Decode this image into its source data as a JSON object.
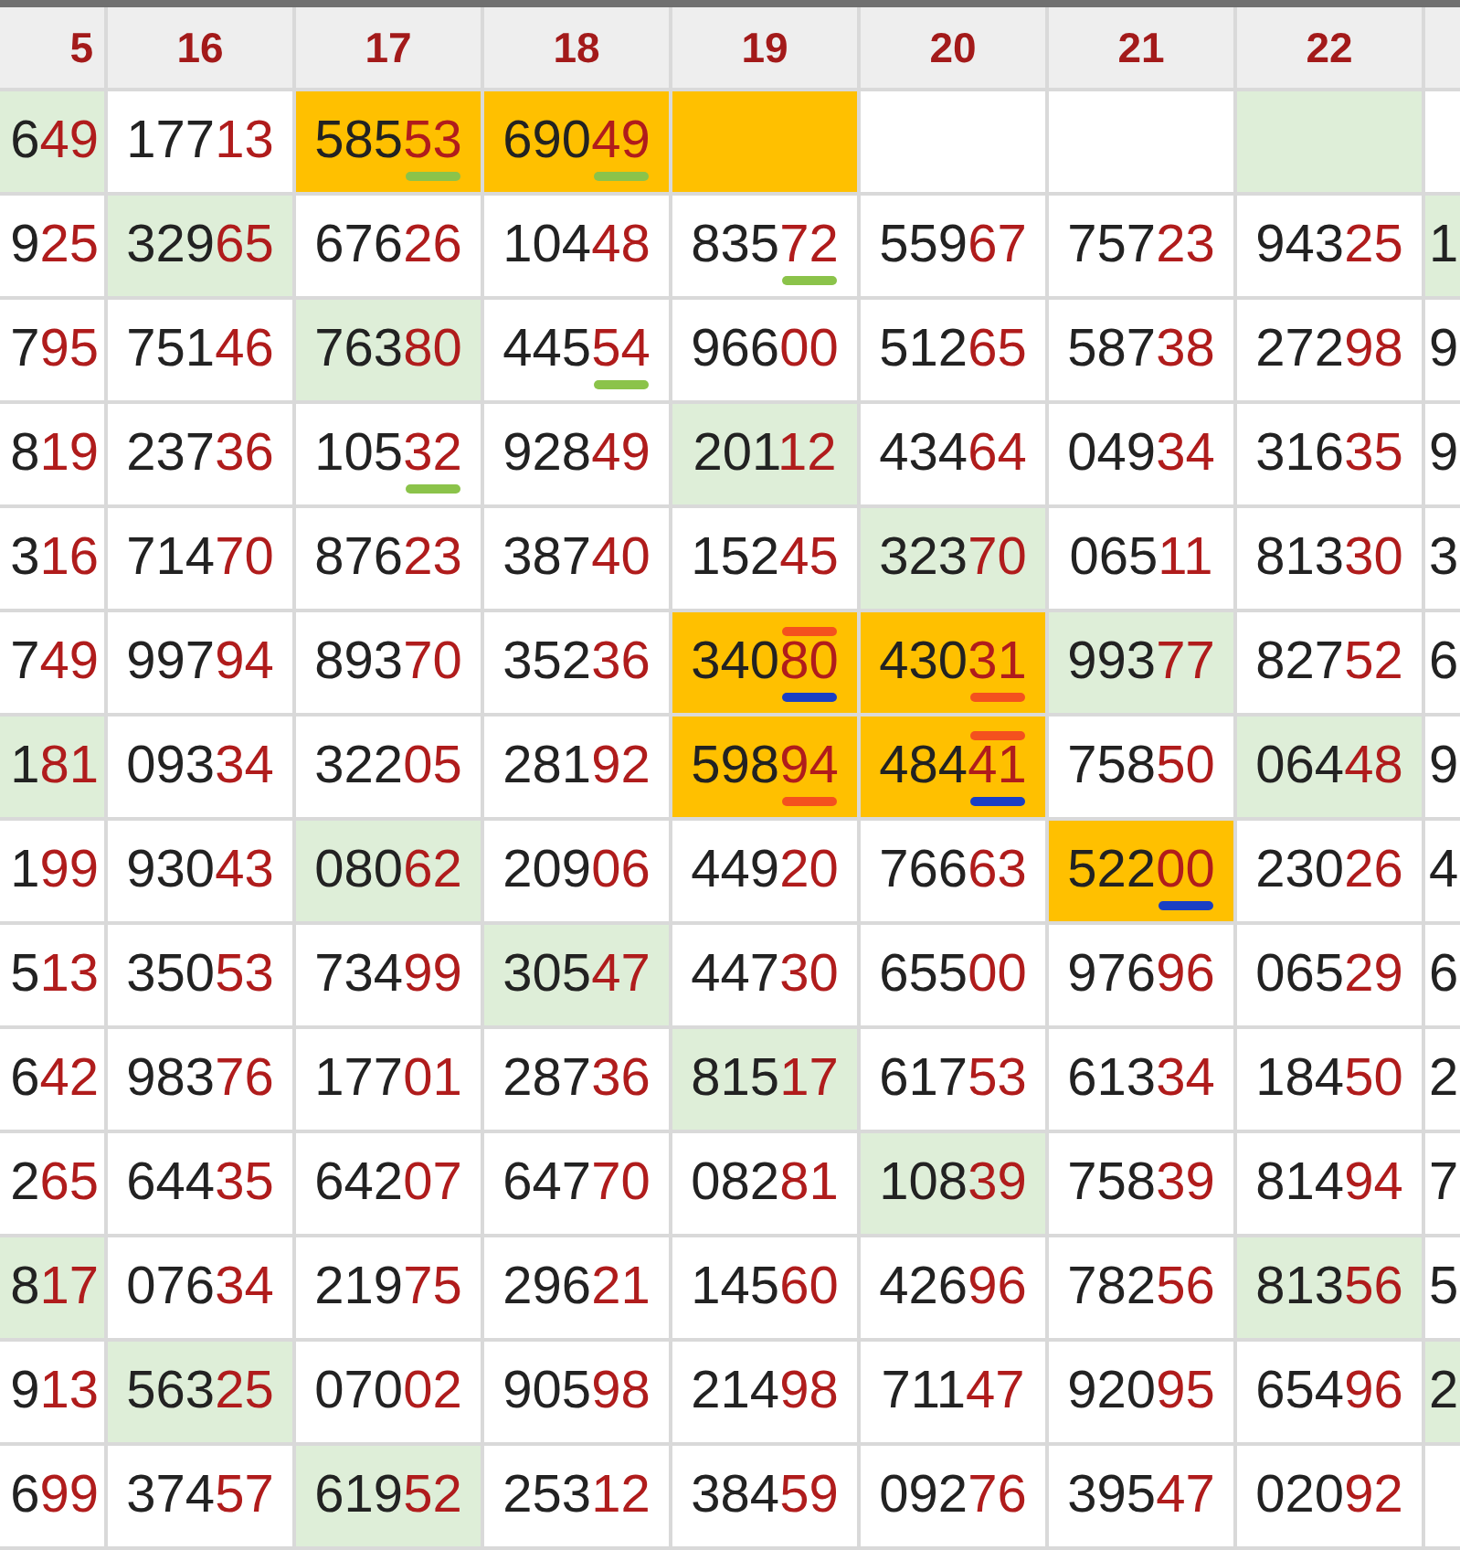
{
  "header": [
    "5",
    "16",
    "17",
    "18",
    "19",
    "20",
    "21",
    "22"
  ],
  "rows": [
    {
      "cells": [
        {
          "text": "649",
          "color": "#deeed8"
        },
        {
          "text": "17713"
        },
        {
          "text": "58553",
          "color": "#ffc000",
          "marks": [
            {
              "kind": "underline",
              "color": "#8bc34a"
            }
          ]
        },
        {
          "text": "69049",
          "color": "#ffc000",
          "marks": [
            {
              "kind": "underline",
              "color": "#8bc34a"
            }
          ]
        },
        {
          "color": "#ffc000"
        },
        {},
        {},
        {
          "color": "#deeed8"
        },
        {}
      ]
    },
    {
      "cells": [
        {
          "text": "925"
        },
        {
          "text": "32965",
          "color": "#deeed8"
        },
        {
          "text": "67626"
        },
        {
          "text": "10448"
        },
        {
          "text": "83572",
          "marks": [
            {
              "kind": "underline",
              "color": "#8bc34a"
            }
          ]
        },
        {
          "text": "55967"
        },
        {
          "text": "75723"
        },
        {
          "text": "94325"
        },
        {
          "text": "1",
          "color": "#deeed8"
        }
      ]
    },
    {
      "cells": [
        {
          "text": "795"
        },
        {
          "text": "75146"
        },
        {
          "text": "76380",
          "color": "#deeed8"
        },
        {
          "text": "44554",
          "marks": [
            {
              "kind": "underline",
              "color": "#8bc34a"
            }
          ]
        },
        {
          "text": "96600"
        },
        {
          "text": "51265"
        },
        {
          "text": "58738"
        },
        {
          "text": "27298"
        },
        {
          "text": "9"
        }
      ]
    },
    {
      "cells": [
        {
          "text": "819"
        },
        {
          "text": "23736"
        },
        {
          "text": "10532",
          "marks": [
            {
              "kind": "underline",
              "color": "#8bc34a"
            }
          ]
        },
        {
          "text": "92849"
        },
        {
          "text": "20112",
          "color": "#deeed8"
        },
        {
          "text": "43464"
        },
        {
          "text": "04934"
        },
        {
          "text": "31635"
        },
        {
          "text": "9"
        }
      ]
    },
    {
      "cells": [
        {
          "text": "316"
        },
        {
          "text": "71470"
        },
        {
          "text": "87623"
        },
        {
          "text": "38740"
        },
        {
          "text": "15245"
        },
        {
          "text": "32370",
          "color": "#deeed8"
        },
        {
          "text": "06511"
        },
        {
          "text": "81330"
        },
        {
          "text": "3"
        }
      ]
    },
    {
      "cells": [
        {
          "text": "749"
        },
        {
          "text": "99794"
        },
        {
          "text": "89370"
        },
        {
          "text": "35236"
        },
        {
          "text": "34080",
          "color": "#ffc000",
          "marks": [
            {
              "kind": "overline",
              "color": "#f4511e"
            },
            {
              "kind": "underline",
              "color": "#1a3fc4"
            }
          ]
        },
        {
          "text": "43031",
          "color": "#ffc000",
          "marks": [
            {
              "kind": "underline",
              "color": "#f4511e"
            }
          ]
        },
        {
          "text": "99377",
          "color": "#deeed8"
        },
        {
          "text": "82752"
        },
        {
          "text": "6"
        }
      ]
    },
    {
      "cells": [
        {
          "text": "181",
          "color": "#deeed8"
        },
        {
          "text": "09334"
        },
        {
          "text": "32205"
        },
        {
          "text": "28192"
        },
        {
          "text": "59894",
          "color": "#ffc000",
          "marks": [
            {
              "kind": "underline",
              "color": "#f4511e"
            }
          ]
        },
        {
          "text": "48441",
          "color": "#ffc000",
          "marks": [
            {
              "kind": "overline",
              "color": "#f4511e"
            },
            {
              "kind": "underline",
              "color": "#1a3fc4"
            }
          ]
        },
        {
          "text": "75850"
        },
        {
          "text": "06448",
          "color": "#deeed8"
        },
        {
          "text": "9"
        }
      ]
    },
    {
      "cells": [
        {
          "text": "199"
        },
        {
          "text": "93043"
        },
        {
          "text": "08062",
          "color": "#deeed8"
        },
        {
          "text": "20906"
        },
        {
          "text": "44920"
        },
        {
          "text": "76663"
        },
        {
          "text": "52200",
          "color": "#ffc000",
          "marks": [
            {
              "kind": "underline",
              "color": "#1a3fc4"
            }
          ]
        },
        {
          "text": "23026"
        },
        {
          "text": "4"
        }
      ]
    },
    {
      "cells": [
        {
          "text": "513"
        },
        {
          "text": "35053"
        },
        {
          "text": "73499"
        },
        {
          "text": "30547",
          "color": "#deeed8"
        },
        {
          "text": "44730"
        },
        {
          "text": "65500"
        },
        {
          "text": "97696"
        },
        {
          "text": "06529"
        },
        {
          "text": "6"
        }
      ]
    },
    {
      "cells": [
        {
          "text": "642"
        },
        {
          "text": "98376"
        },
        {
          "text": "17701"
        },
        {
          "text": "28736"
        },
        {
          "text": "81517",
          "color": "#deeed8"
        },
        {
          "text": "61753"
        },
        {
          "text": "61334"
        },
        {
          "text": "18450"
        },
        {
          "text": "2"
        }
      ]
    },
    {
      "cells": [
        {
          "text": "265"
        },
        {
          "text": "64435"
        },
        {
          "text": "64207"
        },
        {
          "text": "64770"
        },
        {
          "text": "08281"
        },
        {
          "text": "10839",
          "color": "#deeed8"
        },
        {
          "text": "75839"
        },
        {
          "text": "81494"
        },
        {
          "text": "7"
        }
      ]
    },
    {
      "cells": [
        {
          "text": "817",
          "color": "#deeed8"
        },
        {
          "text": "07634"
        },
        {
          "text": "21975"
        },
        {
          "text": "29621"
        },
        {
          "text": "14560"
        },
        {
          "text": "42696"
        },
        {
          "text": "78256"
        },
        {
          "text": "81356",
          "color": "#deeed8"
        },
        {
          "text": "5"
        }
      ]
    },
    {
      "cells": [
        {
          "text": "913"
        },
        {
          "text": "56325",
          "color": "#deeed8"
        },
        {
          "text": "07002"
        },
        {
          "text": "90598"
        },
        {
          "text": "21498"
        },
        {
          "text": "71147"
        },
        {
          "text": "92095"
        },
        {
          "text": "65496"
        },
        {
          "text": "2",
          "color": "#deeed8"
        }
      ]
    },
    {
      "cells": [
        {
          "text": "699"
        },
        {
          "text": "37457"
        },
        {
          "text": "61952",
          "color": "#deeed8"
        },
        {
          "text": "25312"
        },
        {
          "text": "38459"
        },
        {
          "text": "09276"
        },
        {
          "text": "39547"
        },
        {
          "text": "02092"
        },
        {}
      ]
    }
  ]
}
